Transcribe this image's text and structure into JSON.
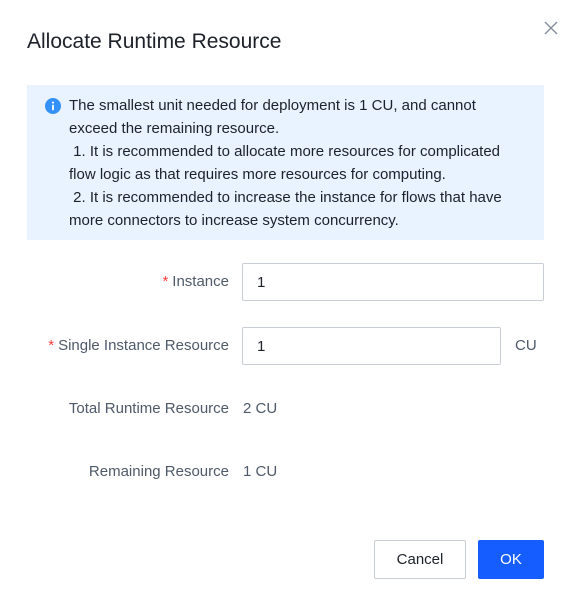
{
  "dialog": {
    "title": "Allocate Runtime Resource",
    "close_icon": "close-icon"
  },
  "notice": {
    "icon": "info-icon",
    "lines": [
      "The smallest unit needed for deployment is 1 CU, and cannot",
      "exceed the remaining resource.",
      " 1. It is recommended to allocate more resources for complicated",
      "flow logic as that requires more resources for computing.",
      " 2. It is recommended to increase the instance for flows that have",
      "more connectors to increase system concurrency."
    ]
  },
  "form": {
    "instance": {
      "required_mark": "*",
      "label": "Instance",
      "value": "1"
    },
    "single_instance_resource": {
      "required_mark": "*",
      "label": "Single Instance Resource",
      "value": "1",
      "unit": "CU"
    },
    "total_runtime_resource": {
      "label": "Total Runtime Resource",
      "value": "2 CU"
    },
    "remaining_resource": {
      "label": "Remaining Resource",
      "value": "1 CU"
    }
  },
  "footer": {
    "cancel_label": "Cancel",
    "ok_label": "OK"
  },
  "colors": {
    "primary": "#165dff",
    "notice_bg": "#e8f3ff",
    "required": "#f53f3f",
    "info_icon": "#3491fa"
  }
}
